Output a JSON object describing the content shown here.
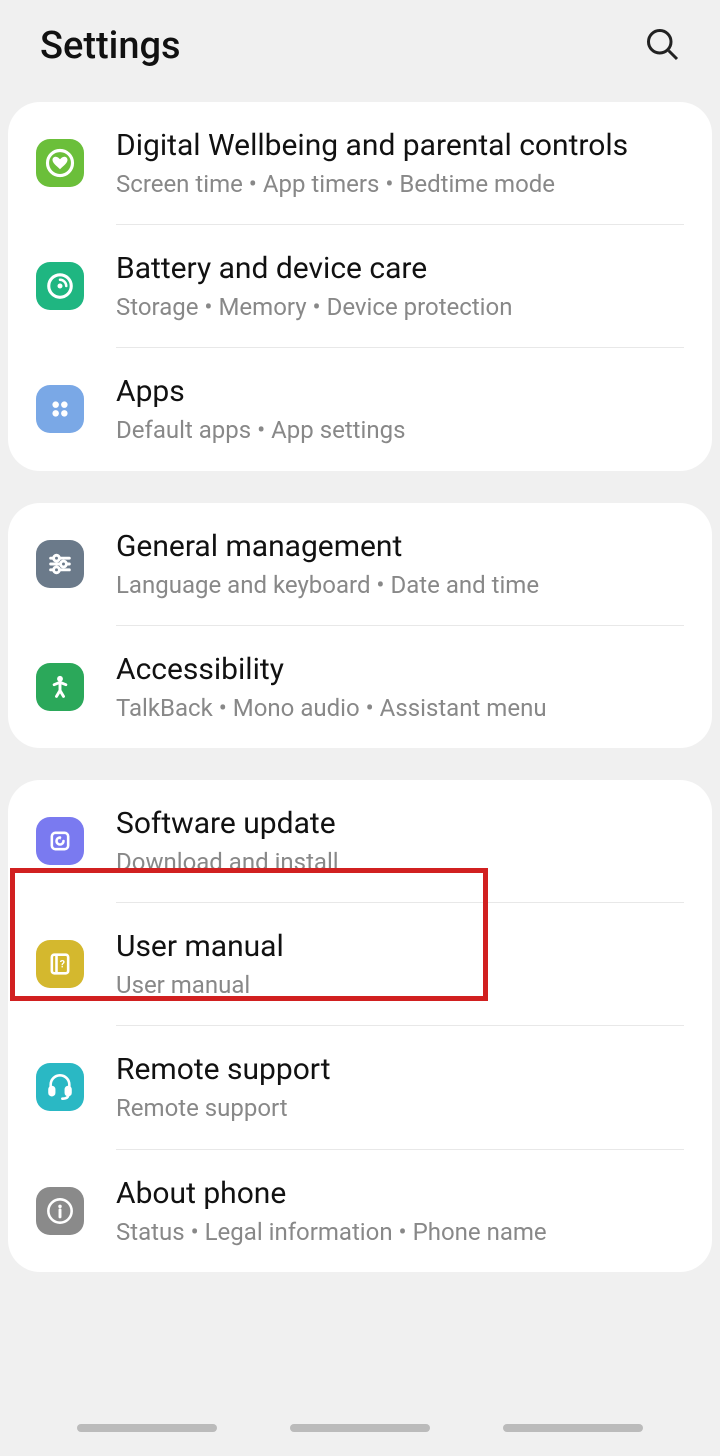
{
  "header": {
    "title": "Settings"
  },
  "groups": [
    {
      "items": [
        {
          "id": "digital-wellbeing",
          "title": "Digital Wellbeing and parental controls",
          "subtitle": "Screen time  •  App timers  •  Bedtime mode",
          "iconBg": "#6bbf3a",
          "iconName": "wellbeing-icon"
        },
        {
          "id": "battery-care",
          "title": "Battery and device care",
          "subtitle": "Storage  •  Memory  •  Device protection",
          "iconBg": "#1fb681",
          "iconName": "battery-care-icon"
        },
        {
          "id": "apps",
          "title": "Apps",
          "subtitle": "Default apps  •  App settings",
          "iconBg": "#7aa8e6",
          "iconName": "apps-icon"
        }
      ]
    },
    {
      "items": [
        {
          "id": "general-management",
          "title": "General management",
          "subtitle": "Language and keyboard  •  Date and time",
          "iconBg": "#6b7a8a",
          "iconName": "general-icon"
        },
        {
          "id": "accessibility",
          "title": "Accessibility",
          "subtitle": "TalkBack  •  Mono audio  •  Assistant menu",
          "iconBg": "#2ba85a",
          "iconName": "accessibility-icon"
        }
      ]
    },
    {
      "items": [
        {
          "id": "software-update",
          "title": "Software update",
          "subtitle": "Download and install",
          "iconBg": "#7a7af0",
          "iconName": "update-icon"
        },
        {
          "id": "user-manual",
          "title": "User manual",
          "subtitle": "User manual",
          "iconBg": "#d4b82e",
          "iconName": "manual-icon"
        },
        {
          "id": "remote-support",
          "title": "Remote support",
          "subtitle": "Remote support",
          "iconBg": "#2ab8c4",
          "iconName": "support-icon"
        },
        {
          "id": "about-phone",
          "title": "About phone",
          "subtitle": "Status  •  Legal information  •  Phone name",
          "iconBg": "#8a8a8a",
          "iconName": "about-icon"
        }
      ]
    }
  ]
}
